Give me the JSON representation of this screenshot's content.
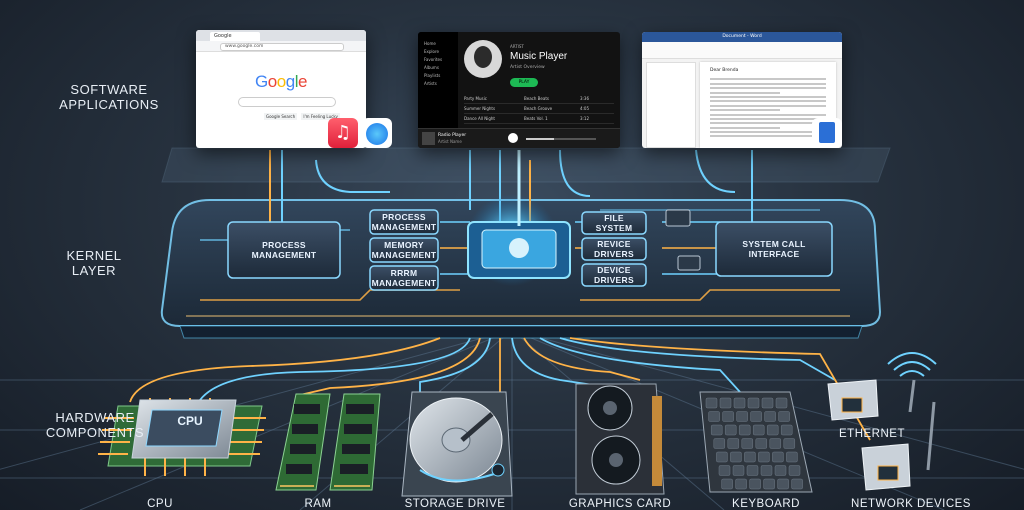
{
  "section_labels": {
    "software": "SOFTWARE\nAPPLICATIONS",
    "kernel": "KERNEL\nLAYER",
    "hardware": "HARDWARE\nCOMPONENTS"
  },
  "browser": {
    "tab_title": "Google",
    "url": "www.google.com",
    "logo": "Google",
    "buttons": [
      "Google Search",
      "I'm Feeling Lucky"
    ]
  },
  "music_player": {
    "section": "ARTIST",
    "title": "Music Player",
    "artist": "Artist Overview",
    "play_label": "PLAY",
    "nav": [
      "Home",
      "Explore",
      "Favorites",
      "Albums",
      "Playlists",
      "Artists"
    ],
    "tracks": [
      {
        "name": "Party Music",
        "artist": "Beach Beats",
        "time": "3:36"
      },
      {
        "name": "Summer Nights",
        "artist": "Beach Groove",
        "time": "4:05"
      },
      {
        "name": "Dance All Night",
        "artist": "Beats Vol. 1",
        "time": "3:12"
      }
    ],
    "now_playing": "Radio Player",
    "now_artist": "Artist Name"
  },
  "word_doc": {
    "title": "Document - Word",
    "heading": "Dear Brenda"
  },
  "kernel": {
    "chips": {
      "process_left": "PROCESS\nMANAGEMENT",
      "process_mid": "PROCESS\nMANAGEMENT",
      "memory": "MEMORY\nMANAGEMENT",
      "rrrm": "RRRM\nMANAGEMENT",
      "file_system": "FILE\nSYSTEM",
      "revice": "REVICE\nDRIVERS",
      "device": "DEVICE\nDRIVERS",
      "syscall": "SYSTEM CALL\nINTERFACE"
    }
  },
  "hardware": {
    "cpu_chip": "CPU",
    "ethernet": "ETHERNET",
    "captions": [
      "CPU",
      "RAM",
      "STORAGE DRIVE",
      "GRAPHICS CARD",
      "KEYBOARD",
      "NETWORK DEVICES"
    ]
  },
  "colors": {
    "accent_blue": "#6fd2ff",
    "accent_orange": "#ffb347",
    "spotify_green": "#1db954"
  }
}
